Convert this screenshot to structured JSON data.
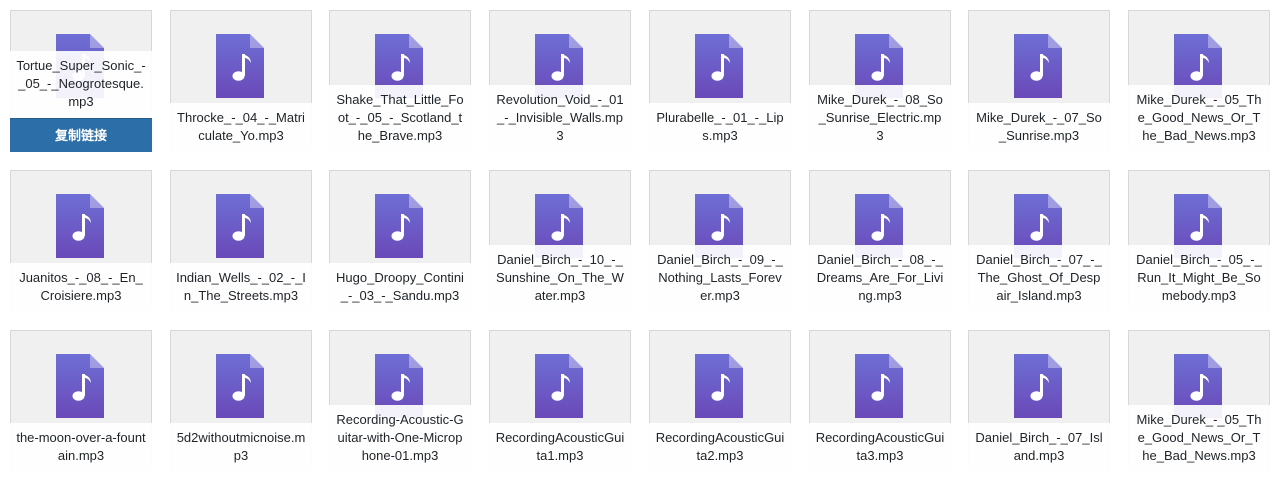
{
  "media_library": {
    "copy_link_label": "复制链接",
    "rows": [
      [
        {
          "name": "Tortue_Super_Sonic_-_05_-_Neogrotesque.mp3",
          "hovered": true
        },
        {
          "name": "Throcke_-_04_-_Matriculate_Yo.mp3"
        },
        {
          "name": "Shake_That_Little_Foot_-_05_-_Scotland_the_Brave.mp3"
        },
        {
          "name": "Revolution_Void_-_01_-_Invisible_Walls.mp3"
        },
        {
          "name": "Plurabelle_-_01_-_Lips.mp3"
        },
        {
          "name": "Mike_Durek_-_08_So_Sunrise_Electric.mp3"
        },
        {
          "name": "Mike_Durek_-_07_So_Sunrise.mp3"
        },
        {
          "name": "Mike_Durek_-_05_The_Good_News_Or_The_Bad_News.mp3"
        }
      ],
      [
        {
          "name": "Juanitos_-_08_-_En_Croisiere.mp3"
        },
        {
          "name": "Indian_Wells_-_02_-_In_The_Streets.mp3"
        },
        {
          "name": "Hugo_Droopy_Contini_-_03_-_Sandu.mp3"
        },
        {
          "name": "Daniel_Birch_-_10_-_Sunshine_On_The_Water.mp3"
        },
        {
          "name": "Daniel_Birch_-_09_-_Nothing_Lasts_Forever.mp3"
        },
        {
          "name": "Daniel_Birch_-_08_-_Dreams_Are_For_Living.mp3"
        },
        {
          "name": "Daniel_Birch_-_07_-_The_Ghost_Of_Despair_Island.mp3"
        },
        {
          "name": "Daniel_Birch_-_05_-_Run_It_Might_Be_Somebody.mp3"
        }
      ],
      [
        {
          "name": "the-moon-over-a-fountain.mp3"
        },
        {
          "name": "5d2withoutmicnoise.mp3"
        },
        {
          "name": "Recording-Acoustic-Guitar-with-One-Microphone-01.mp3"
        },
        {
          "name": "RecordingAcousticGuita1.mp3"
        },
        {
          "name": "RecordingAcousticGuita2.mp3"
        },
        {
          "name": "RecordingAcousticGuita3.mp3"
        },
        {
          "name": "Daniel_Birch_-_07_Island.mp3"
        },
        {
          "name": "Mike_Durek_-_05_The_Good_News_Or_The_Bad_News.mp3"
        }
      ]
    ],
    "icon": "audio-file-icon",
    "colors": {
      "icon_top": "#6e6fd6",
      "icon_bottom": "#6a49b8",
      "tile_bg": "#f0f0f1",
      "button_bg": "#2c6fa8"
    }
  }
}
